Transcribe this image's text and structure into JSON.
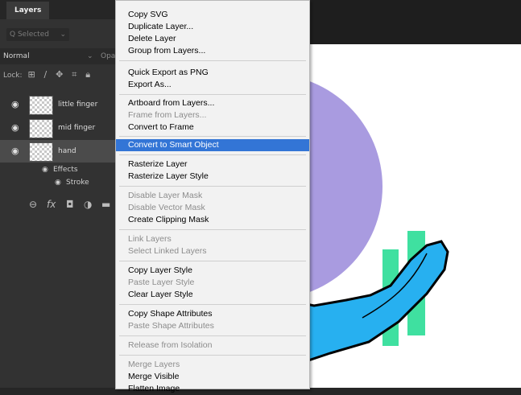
{
  "layers_panel": {
    "tab": "Layers",
    "search_placeholder": "Q Selected",
    "blend_mode": "Normal",
    "opacity_label": "Opa",
    "lock_label": "Lock:",
    "layers": [
      {
        "name": "little finger",
        "visible": true
      },
      {
        "name": "mid finger",
        "visible": true
      },
      {
        "name": "hand",
        "visible": true,
        "selected": true
      }
    ],
    "effects_label": "Effects",
    "stroke_label": "Stroke"
  },
  "context_menu": {
    "items": [
      {
        "label": "Copy SVG",
        "enabled": true
      },
      {
        "label": "Duplicate Layer...",
        "enabled": true
      },
      {
        "label": "Delete Layer",
        "enabled": true
      },
      {
        "label": "Group from Layers...",
        "enabled": true
      },
      {
        "label": "Quick Export as PNG",
        "enabled": true
      },
      {
        "label": "Export As...",
        "enabled": true
      },
      {
        "label": "Artboard from Layers...",
        "enabled": true
      },
      {
        "label": "Frame from Layers...",
        "enabled": false
      },
      {
        "label": "Convert to Frame",
        "enabled": true
      },
      {
        "label": "Convert to Smart Object",
        "enabled": true,
        "highlighted": true
      },
      {
        "label": "Rasterize Layer",
        "enabled": true
      },
      {
        "label": "Rasterize Layer Style",
        "enabled": true
      },
      {
        "label": "Disable Layer Mask",
        "enabled": false
      },
      {
        "label": "Disable Vector Mask",
        "enabled": false
      },
      {
        "label": "Create Clipping Mask",
        "enabled": true
      },
      {
        "label": "Link Layers",
        "enabled": false
      },
      {
        "label": "Select Linked Layers",
        "enabled": false
      },
      {
        "label": "Copy Layer Style",
        "enabled": true
      },
      {
        "label": "Paste Layer Style",
        "enabled": false
      },
      {
        "label": "Clear Layer Style",
        "enabled": true
      },
      {
        "label": "Copy Shape Attributes",
        "enabled": true
      },
      {
        "label": "Paste Shape Attributes",
        "enabled": false
      },
      {
        "label": "Release from Isolation",
        "enabled": false
      },
      {
        "label": "Merge Layers",
        "enabled": false
      },
      {
        "label": "Merge Visible",
        "enabled": true
      },
      {
        "label": "Flatten Image",
        "enabled": true
      }
    ]
  },
  "colors": {
    "circle": "#a99be0",
    "hand": "#27b0f0",
    "bars": "#3fe0a0",
    "highlight": "#3375d6"
  }
}
